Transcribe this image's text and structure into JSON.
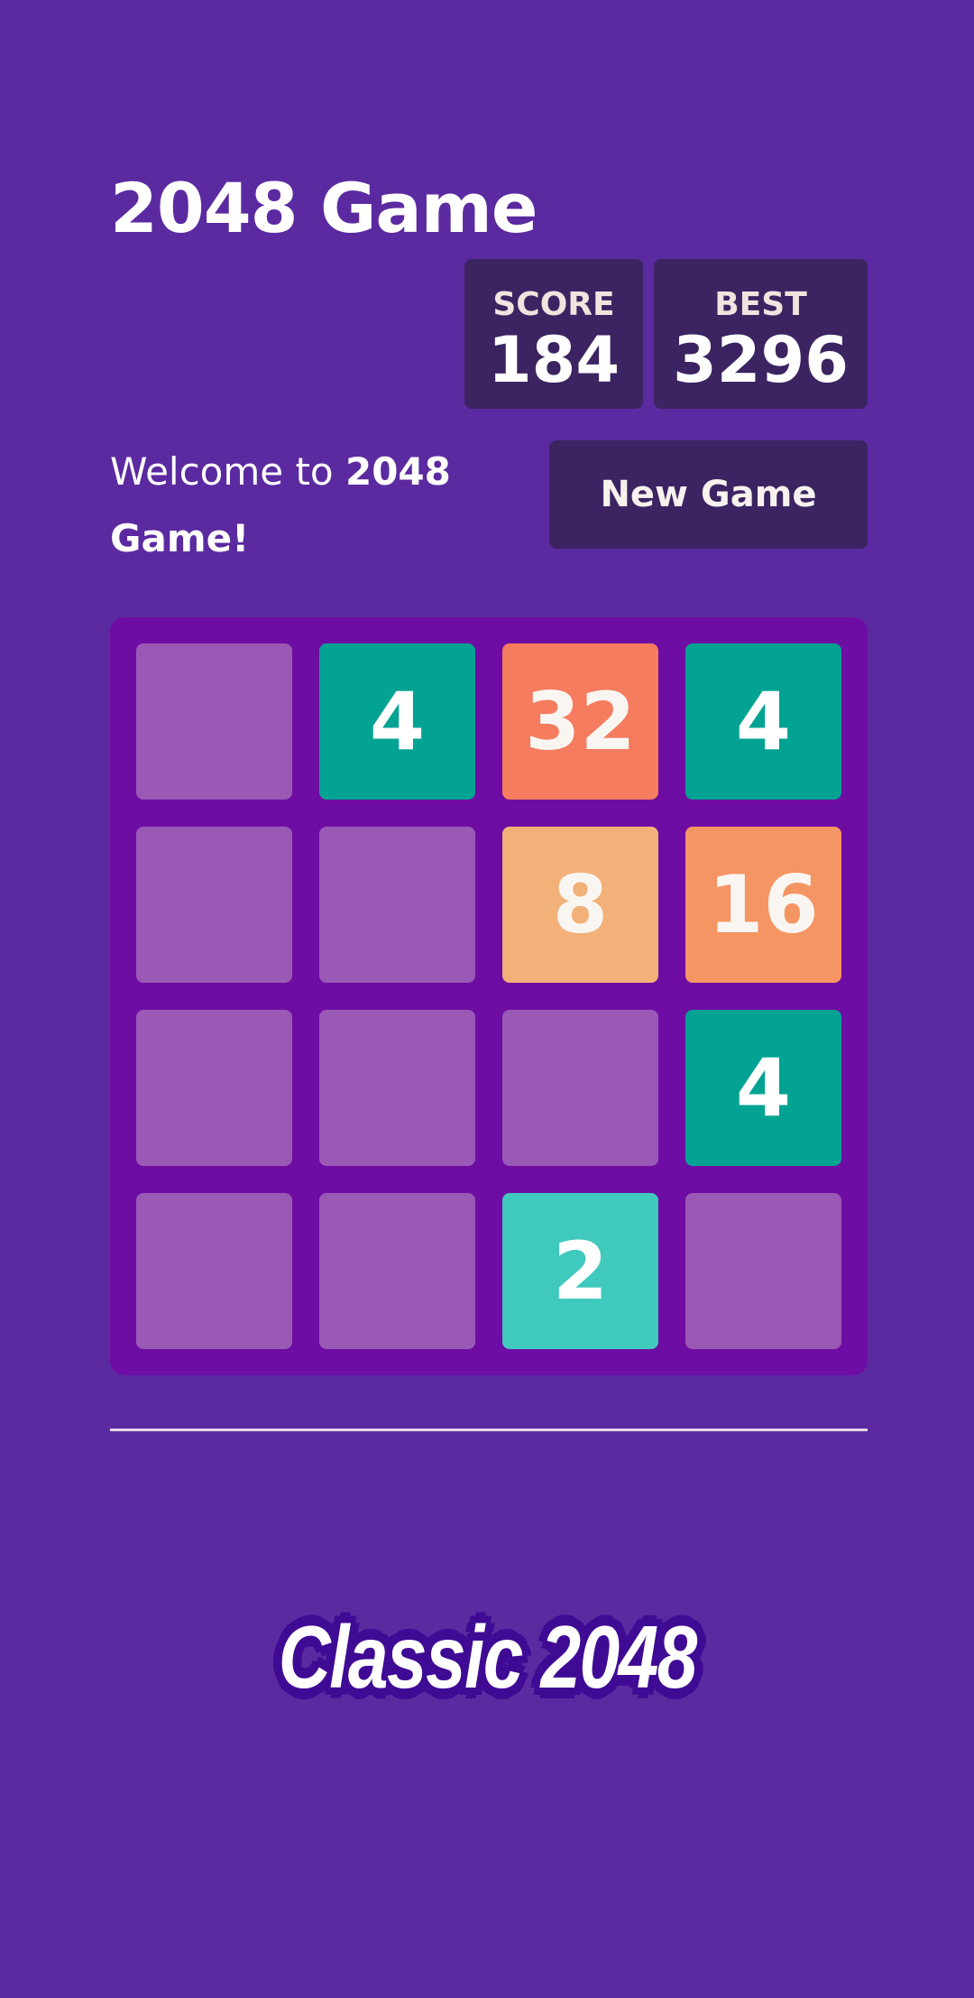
{
  "header": {
    "title": "2048 Game",
    "score_label": "SCORE",
    "score_value": "184",
    "best_label": "BEST",
    "best_value": "3296"
  },
  "intro": {
    "welcome_prefix": "Welcome to ",
    "welcome_bold": "2048 Game!",
    "new_game_label": "New Game"
  },
  "board": {
    "size": 4,
    "cells": [
      [
        null,
        4,
        32,
        4
      ],
      [
        null,
        null,
        8,
        16
      ],
      [
        null,
        null,
        null,
        4
      ],
      [
        null,
        null,
        2,
        null
      ]
    ],
    "colors": {
      "empty": "#9b59b6",
      "2": "#40c9bd",
      "4": "#03a394",
      "8": "#f2b179",
      "16": "#f59563",
      "32": "#f57c5f"
    },
    "text_colors": {
      "2": "#ffffff",
      "4": "#ffffff",
      "8": "#f9f6f2",
      "16": "#f9f6f2",
      "32": "#f9f6f2"
    }
  },
  "footer": {
    "logo_text": "Classic 2048"
  }
}
